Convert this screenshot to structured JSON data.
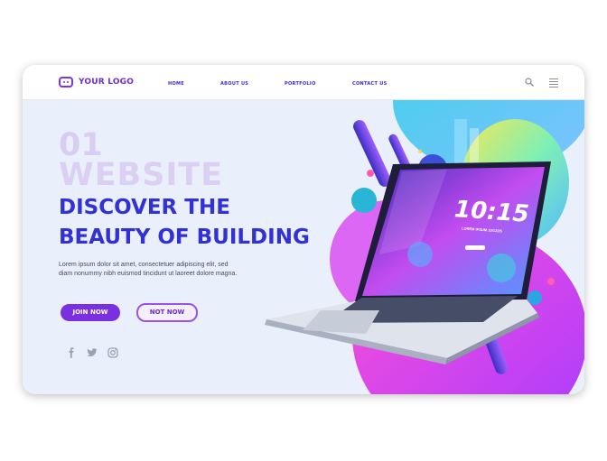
{
  "logo": {
    "text": "YOUR LOGO"
  },
  "nav": {
    "items": [
      "HOME",
      "ABOUT US",
      "PORTFOLIO",
      "CONTACT US"
    ]
  },
  "hero": {
    "number": "01",
    "ghost": "WEBSITE",
    "headline_line1": "DISCOVER THE",
    "headline_line2": "BEAUTY OF BUILDING",
    "body_line1": "Lorem ipsum dolor sit amet, consectetuer adipiscing elit, sed",
    "body_line2": "diam nonummy nibh euismod tincidunt ut laoreet dolore magna.",
    "join_label": "JOIN NOW",
    "not_label": "NOT NOW"
  },
  "laptop": {
    "time": "10:15",
    "date": "LOREM IPSUM 10/12/25"
  },
  "social": [
    "facebook-icon",
    "twitter-icon",
    "instagram-icon"
  ],
  "colors": {
    "primary": "#7a30e0",
    "headline": "#3131d6",
    "ghost": "#d9cdf3",
    "background": "#eaf0fb"
  }
}
